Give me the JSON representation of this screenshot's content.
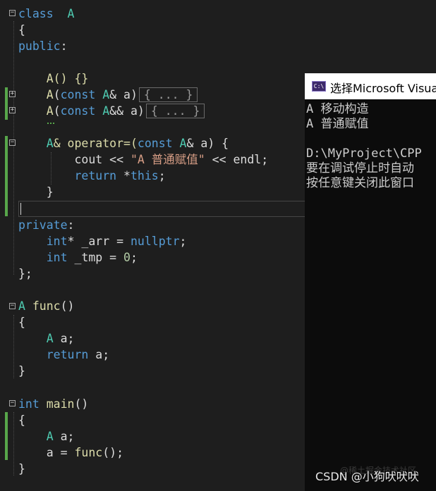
{
  "code": {
    "l1_class": "class",
    "l1_name": "A",
    "brace_open": "{",
    "public": "public",
    "colon": ":",
    "ctor_default": "A() {}",
    "copy_ctor_name": "A",
    "const": "const",
    "copy_ctor_type": "A",
    "copy_ctor_rest": "& a)",
    "collapsed": "{ ... }",
    "move_ctor_name": "A",
    "move_ctor_type": "A",
    "move_ctor_rest": "&& a)",
    "op_ret": "A",
    "op_decl": "& operator=(",
    "op_type": "A",
    "op_rest": "& a) {",
    "cout": "cout << ",
    "string": "\"A 普通赋值\"",
    "endl": " << endl;",
    "return_kw": "return",
    "return_this_pre": " *",
    "this_kw": "this",
    "semi": ";",
    "brace_close": "}",
    "private": "private",
    "int_kw": "int",
    "arr_decl": "* _arr = ",
    "nullptr": "nullptr",
    "tmp_decl": " _tmp = ",
    "zero": "0",
    "class_end": "};",
    "func_ret": "A",
    "func_name": "func",
    "parens": "()",
    "local_type": "A",
    "local_var": " a;",
    "return_a": " a;",
    "main_ret": "int",
    "main_name": "main",
    "assign": "a = ",
    "call": "func",
    "call_end": "();"
  },
  "console": {
    "title": "选择Microsoft Visual Studio 调试控制台",
    "icon_label": "C:\\",
    "lines": [
      "A 移动构造",
      "A 普通赋值",
      "",
      "D:\\MyProject\\CPP",
      "要在调试停止时自动",
      "按任意键关闭此窗口"
    ]
  },
  "watermark": {
    "text": "CSDN @小狗吠吠吠",
    "ghost": "@稀土掘金技术社区"
  },
  "colors": {
    "editor_bg": "#1e1e1e",
    "keyword": "#569cd6",
    "type": "#4ec9b0",
    "function": "#dcdcaa",
    "string": "#d69d85",
    "number": "#b5cea8",
    "change_bar": "#57a64a",
    "console_bg": "#0c0c0c"
  }
}
